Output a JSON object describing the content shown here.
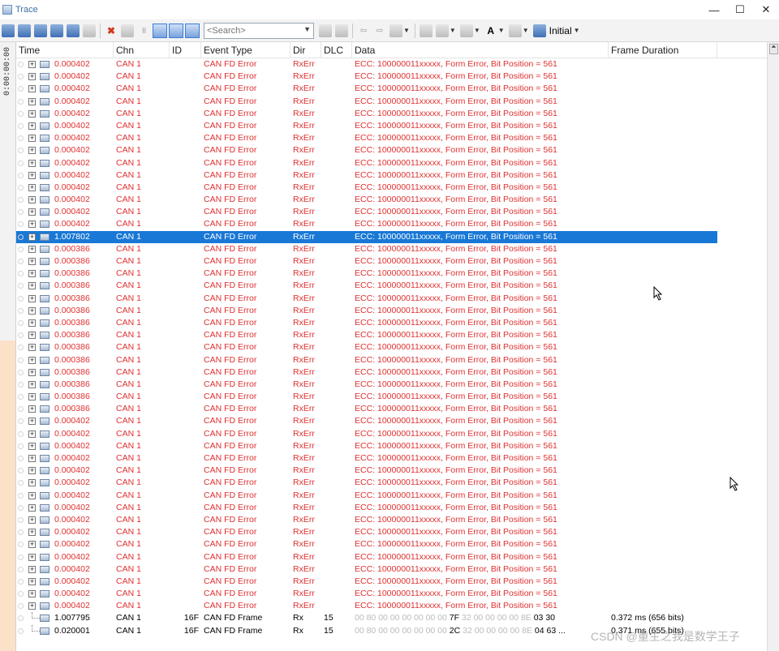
{
  "window": {
    "title": "Trace"
  },
  "window_buttons": [
    "—",
    "☐",
    "✕"
  ],
  "toolbar": {
    "search_placeholder": "<Search>",
    "initial_label": "Initial"
  },
  "left_strip": {
    "time_text": "0:00:00:00"
  },
  "columns": [
    "Time",
    "Chn",
    "ID",
    "Event Type",
    "Dir",
    "DLC",
    "Data",
    "Frame Duration"
  ],
  "rows": [
    {
      "time": "0.000402",
      "chn": "CAN 1",
      "id": "",
      "event": "CAN FD Error",
      "dir": "RxErr",
      "dlc": "",
      "data": "ECC: 100000011xxxxx, Form Error, Bit Position = 561"
    },
    {
      "time": "0.000402",
      "chn": "CAN 1",
      "id": "",
      "event": "CAN FD Error",
      "dir": "RxErr",
      "dlc": "",
      "data": "ECC: 100000011xxxxx, Form Error, Bit Position = 561"
    },
    {
      "time": "0.000402",
      "chn": "CAN 1",
      "id": "",
      "event": "CAN FD Error",
      "dir": "RxErr",
      "dlc": "",
      "data": "ECC: 100000011xxxxx, Form Error, Bit Position = 561"
    },
    {
      "time": "0.000402",
      "chn": "CAN 1",
      "id": "",
      "event": "CAN FD Error",
      "dir": "RxErr",
      "dlc": "",
      "data": "ECC: 100000011xxxxx, Form Error, Bit Position = 561"
    },
    {
      "time": "0.000402",
      "chn": "CAN 1",
      "id": "",
      "event": "CAN FD Error",
      "dir": "RxErr",
      "dlc": "",
      "data": "ECC: 100000011xxxxx, Form Error, Bit Position = 561"
    },
    {
      "time": "0.000402",
      "chn": "CAN 1",
      "id": "",
      "event": "CAN FD Error",
      "dir": "RxErr",
      "dlc": "",
      "data": "ECC: 100000011xxxxx, Form Error, Bit Position = 561"
    },
    {
      "time": "0.000402",
      "chn": "CAN 1",
      "id": "",
      "event": "CAN FD Error",
      "dir": "RxErr",
      "dlc": "",
      "data": "ECC: 100000011xxxxx, Form Error, Bit Position = 561"
    },
    {
      "time": "0.000402",
      "chn": "CAN 1",
      "id": "",
      "event": "CAN FD Error",
      "dir": "RxErr",
      "dlc": "",
      "data": "ECC: 100000011xxxxx, Form Error, Bit Position = 561"
    },
    {
      "time": "0.000402",
      "chn": "CAN 1",
      "id": "",
      "event": "CAN FD Error",
      "dir": "RxErr",
      "dlc": "",
      "data": "ECC: 100000011xxxxx, Form Error, Bit Position = 561"
    },
    {
      "time": "0.000402",
      "chn": "CAN 1",
      "id": "",
      "event": "CAN FD Error",
      "dir": "RxErr",
      "dlc": "",
      "data": "ECC: 100000011xxxxx, Form Error, Bit Position = 561"
    },
    {
      "time": "0.000402",
      "chn": "CAN 1",
      "id": "",
      "event": "CAN FD Error",
      "dir": "RxErr",
      "dlc": "",
      "data": "ECC: 100000011xxxxx, Form Error, Bit Position = 561"
    },
    {
      "time": "0.000402",
      "chn": "CAN 1",
      "id": "",
      "event": "CAN FD Error",
      "dir": "RxErr",
      "dlc": "",
      "data": "ECC: 100000011xxxxx, Form Error, Bit Position = 561"
    },
    {
      "time": "0.000402",
      "chn": "CAN 1",
      "id": "",
      "event": "CAN FD Error",
      "dir": "RxErr",
      "dlc": "",
      "data": "ECC: 100000011xxxxx, Form Error, Bit Position = 561"
    },
    {
      "time": "0.000402",
      "chn": "CAN 1",
      "id": "",
      "event": "CAN FD Error",
      "dir": "RxErr",
      "dlc": "",
      "data": "ECC: 100000011xxxxx, Form Error, Bit Position = 561"
    },
    {
      "time": "1.007802",
      "chn": "CAN 1",
      "id": "",
      "event": "CAN FD Error",
      "dir": "RxErr",
      "dlc": "",
      "data": "ECC: 100000011xxxxx, Form Error, Bit Position = 561",
      "selected": true
    },
    {
      "time": "0.000386",
      "chn": "CAN 1",
      "id": "",
      "event": "CAN FD Error",
      "dir": "RxErr",
      "dlc": "",
      "data": "ECC: 100000011xxxxx, Form Error, Bit Position = 561"
    },
    {
      "time": "0.000386",
      "chn": "CAN 1",
      "id": "",
      "event": "CAN FD Error",
      "dir": "RxErr",
      "dlc": "",
      "data": "ECC: 100000011xxxxx, Form Error, Bit Position = 561"
    },
    {
      "time": "0.000386",
      "chn": "CAN 1",
      "id": "",
      "event": "CAN FD Error",
      "dir": "RxErr",
      "dlc": "",
      "data": "ECC: 100000011xxxxx, Form Error, Bit Position = 561"
    },
    {
      "time": "0.000386",
      "chn": "CAN 1",
      "id": "",
      "event": "CAN FD Error",
      "dir": "RxErr",
      "dlc": "",
      "data": "ECC: 100000011xxxxx, Form Error, Bit Position = 561"
    },
    {
      "time": "0.000386",
      "chn": "CAN 1",
      "id": "",
      "event": "CAN FD Error",
      "dir": "RxErr",
      "dlc": "",
      "data": "ECC: 100000011xxxxx, Form Error, Bit Position = 561"
    },
    {
      "time": "0.000386",
      "chn": "CAN 1",
      "id": "",
      "event": "CAN FD Error",
      "dir": "RxErr",
      "dlc": "",
      "data": "ECC: 100000011xxxxx, Form Error, Bit Position = 561"
    },
    {
      "time": "0.000386",
      "chn": "CAN 1",
      "id": "",
      "event": "CAN FD Error",
      "dir": "RxErr",
      "dlc": "",
      "data": "ECC: 100000011xxxxx, Form Error, Bit Position = 561"
    },
    {
      "time": "0.000386",
      "chn": "CAN 1",
      "id": "",
      "event": "CAN FD Error",
      "dir": "RxErr",
      "dlc": "",
      "data": "ECC: 100000011xxxxx, Form Error, Bit Position = 561"
    },
    {
      "time": "0.000386",
      "chn": "CAN 1",
      "id": "",
      "event": "CAN FD Error",
      "dir": "RxErr",
      "dlc": "",
      "data": "ECC: 100000011xxxxx, Form Error, Bit Position = 561"
    },
    {
      "time": "0.000386",
      "chn": "CAN 1",
      "id": "",
      "event": "CAN FD Error",
      "dir": "RxErr",
      "dlc": "",
      "data": "ECC: 100000011xxxxx, Form Error, Bit Position = 561"
    },
    {
      "time": "0.000386",
      "chn": "CAN 1",
      "id": "",
      "event": "CAN FD Error",
      "dir": "RxErr",
      "dlc": "",
      "data": "ECC: 100000011xxxxx, Form Error, Bit Position = 561"
    },
    {
      "time": "0.000386",
      "chn": "CAN 1",
      "id": "",
      "event": "CAN FD Error",
      "dir": "RxErr",
      "dlc": "",
      "data": "ECC: 100000011xxxxx, Form Error, Bit Position = 561"
    },
    {
      "time": "0.000386",
      "chn": "CAN 1",
      "id": "",
      "event": "CAN FD Error",
      "dir": "RxErr",
      "dlc": "",
      "data": "ECC: 100000011xxxxx, Form Error, Bit Position = 561"
    },
    {
      "time": "0.000386",
      "chn": "CAN 1",
      "id": "",
      "event": "CAN FD Error",
      "dir": "RxErr",
      "dlc": "",
      "data": "ECC: 100000011xxxxx, Form Error, Bit Position = 561"
    },
    {
      "time": "0.000402",
      "chn": "CAN 1",
      "id": "",
      "event": "CAN FD Error",
      "dir": "RxErr",
      "dlc": "",
      "data": "ECC: 100000011xxxxx, Form Error, Bit Position = 561"
    },
    {
      "time": "0.000402",
      "chn": "CAN 1",
      "id": "",
      "event": "CAN FD Error",
      "dir": "RxErr",
      "dlc": "",
      "data": "ECC: 100000011xxxxx, Form Error, Bit Position = 561"
    },
    {
      "time": "0.000402",
      "chn": "CAN 1",
      "id": "",
      "event": "CAN FD Error",
      "dir": "RxErr",
      "dlc": "",
      "data": "ECC: 100000011xxxxx, Form Error, Bit Position = 561"
    },
    {
      "time": "0.000402",
      "chn": "CAN 1",
      "id": "",
      "event": "CAN FD Error",
      "dir": "RxErr",
      "dlc": "",
      "data": "ECC: 100000011xxxxx, Form Error, Bit Position = 561"
    },
    {
      "time": "0.000402",
      "chn": "CAN 1",
      "id": "",
      "event": "CAN FD Error",
      "dir": "RxErr",
      "dlc": "",
      "data": "ECC: 100000011xxxxx, Form Error, Bit Position = 561"
    },
    {
      "time": "0.000402",
      "chn": "CAN 1",
      "id": "",
      "event": "CAN FD Error",
      "dir": "RxErr",
      "dlc": "",
      "data": "ECC: 100000011xxxxx, Form Error, Bit Position = 561"
    },
    {
      "time": "0.000402",
      "chn": "CAN 1",
      "id": "",
      "event": "CAN FD Error",
      "dir": "RxErr",
      "dlc": "",
      "data": "ECC: 100000011xxxxx, Form Error, Bit Position = 561"
    },
    {
      "time": "0.000402",
      "chn": "CAN 1",
      "id": "",
      "event": "CAN FD Error",
      "dir": "RxErr",
      "dlc": "",
      "data": "ECC: 100000011xxxxx, Form Error, Bit Position = 561"
    },
    {
      "time": "0.000402",
      "chn": "CAN 1",
      "id": "",
      "event": "CAN FD Error",
      "dir": "RxErr",
      "dlc": "",
      "data": "ECC: 100000011xxxxx, Form Error, Bit Position = 561"
    },
    {
      "time": "0.000402",
      "chn": "CAN 1",
      "id": "",
      "event": "CAN FD Error",
      "dir": "RxErr",
      "dlc": "",
      "data": "ECC: 100000011xxxxx, Form Error, Bit Position = 561"
    },
    {
      "time": "0.000402",
      "chn": "CAN 1",
      "id": "",
      "event": "CAN FD Error",
      "dir": "RxErr",
      "dlc": "",
      "data": "ECC: 100000011xxxxx, Form Error, Bit Position = 561"
    },
    {
      "time": "0.000402",
      "chn": "CAN 1",
      "id": "",
      "event": "CAN FD Error",
      "dir": "RxErr",
      "dlc": "",
      "data": "ECC: 100000011xxxxx, Form Error, Bit Position = 561"
    },
    {
      "time": "0.000402",
      "chn": "CAN 1",
      "id": "",
      "event": "CAN FD Error",
      "dir": "RxErr",
      "dlc": "",
      "data": "ECC: 100000011xxxxx, Form Error, Bit Position = 561"
    },
    {
      "time": "0.000402",
      "chn": "CAN 1",
      "id": "",
      "event": "CAN FD Error",
      "dir": "RxErr",
      "dlc": "",
      "data": "ECC: 100000011xxxxx, Form Error, Bit Position = 561"
    },
    {
      "time": "0.000402",
      "chn": "CAN 1",
      "id": "",
      "event": "CAN FD Error",
      "dir": "RxErr",
      "dlc": "",
      "data": "ECC: 100000011xxxxx, Form Error, Bit Position = 561"
    },
    {
      "time": "0.000402",
      "chn": "CAN 1",
      "id": "",
      "event": "CAN FD Error",
      "dir": "RxErr",
      "dlc": "",
      "data": "ECC: 100000011xxxxx, Form Error, Bit Position = 561"
    }
  ],
  "frame_rows": [
    {
      "time": "1.007795",
      "chn": "CAN 1",
      "id": "16F",
      "event": "CAN FD Frame",
      "dir": "Rx",
      "dlc": "15",
      "bytes_pre": "00 80 00 00 00 00 00 00",
      "bytes_hi1": "7F",
      "bytes_mid": "32 00 00 00 00 8E",
      "bytes_hi2": "03 30",
      "duration": "0.372 ms (656 bits)"
    },
    {
      "time": "0.020001",
      "chn": "CAN 1",
      "id": "16F",
      "event": "CAN FD Frame",
      "dir": "Rx",
      "dlc": "15",
      "bytes_pre": "00 80 00 00 00 00 00 00",
      "bytes_hi1": "2C",
      "bytes_mid": "32 00 00 00 00 8E",
      "bytes_hi2": "04 63 ...",
      "duration": "0.371 ms (655 bits)"
    }
  ],
  "colors": {
    "error_text": "#e03030",
    "selection": "#1978d6"
  },
  "watermark": "CSDN @重生之我是数学王子"
}
